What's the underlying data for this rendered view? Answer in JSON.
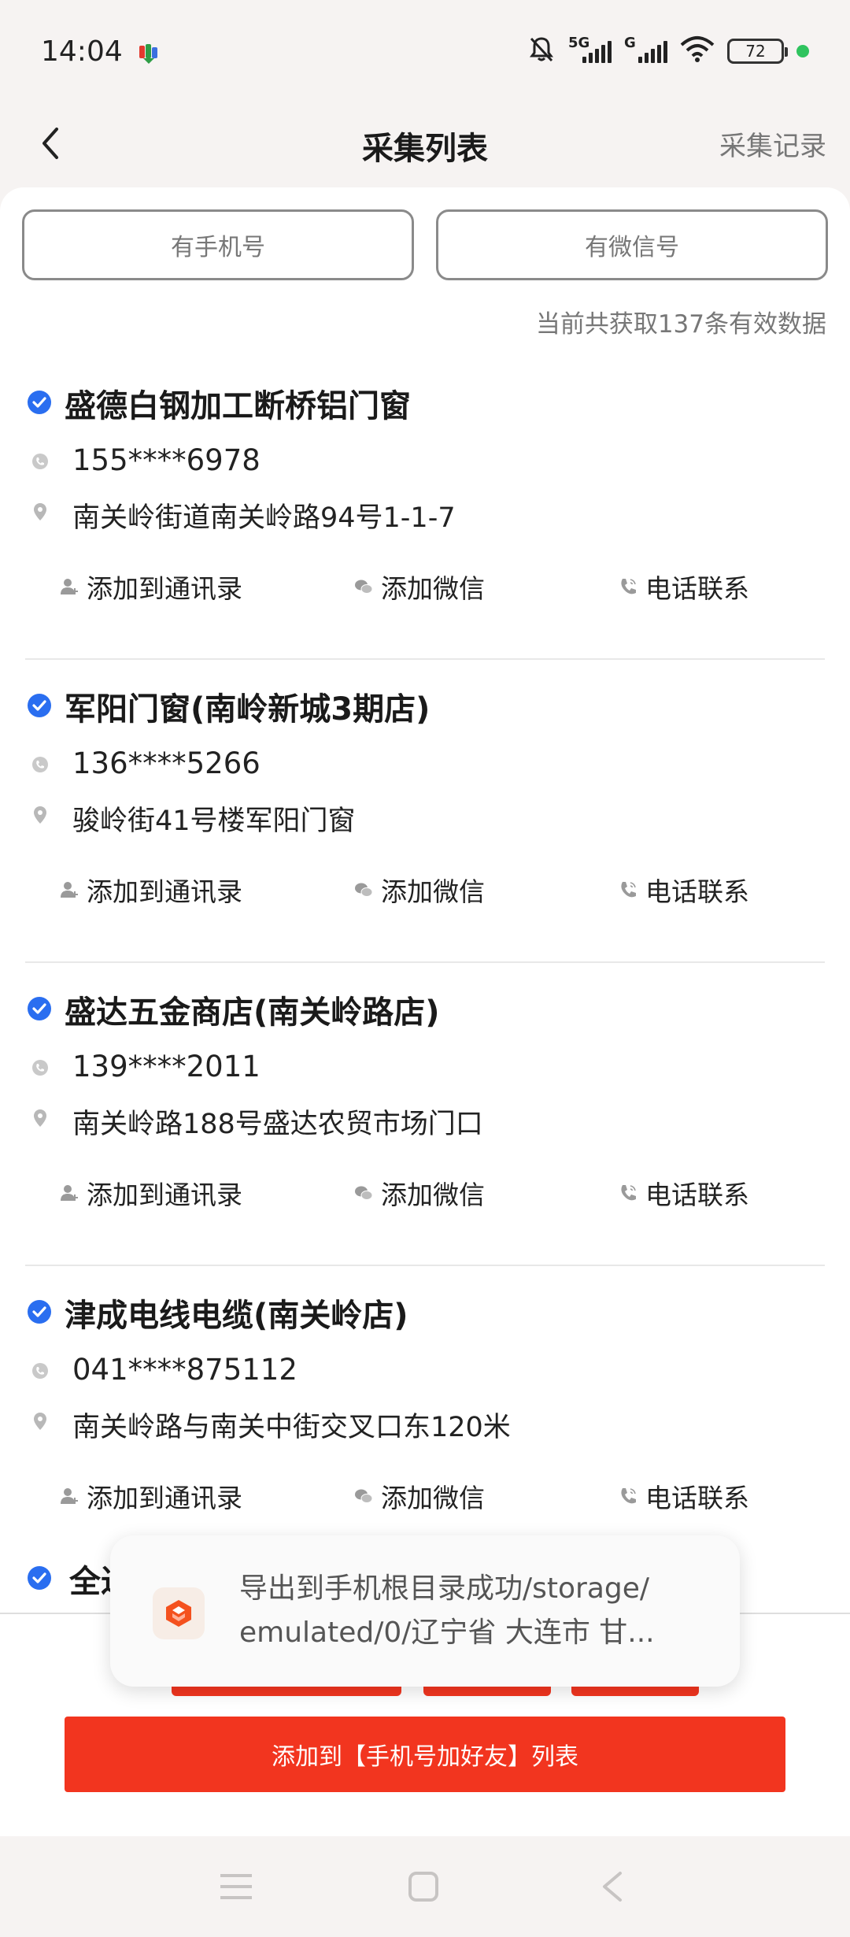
{
  "status_bar": {
    "time": "14:04",
    "battery": "72",
    "sig1_label": "5G",
    "sig2_label": "G"
  },
  "header": {
    "title": "采集列表",
    "right_link": "采集记录"
  },
  "filters": {
    "phone": "有手机号",
    "wechat": "有微信号"
  },
  "count_text": "当前共获取137条有效数据",
  "actions": {
    "add_contact": "添加到通讯录",
    "add_wechat": "添加微信",
    "call": "电话联系"
  },
  "items": [
    {
      "title": "盛德白钢加工断桥铝门窗",
      "phone": "155****6978",
      "address": "南关岭街道南关岭路94号1-1-7"
    },
    {
      "title": "军阳门窗(南岭新城3期店)",
      "phone": "136****5266",
      "address": "骏岭街41号楼军阳门窗"
    },
    {
      "title": "盛达五金商店(南关岭路店)",
      "phone": "139****2011",
      "address": "南关岭路188号盛达农贸市场门口"
    },
    {
      "title": "津成电线电缆(南关岭店)",
      "phone": "041****875112",
      "address": "南关岭路与南关中街交叉口东120米"
    }
  ],
  "partial_item_title": "全过",
  "toast": {
    "line1": "导出到手机根目录成功/storage/",
    "line2": "emulated/0/辽宁省 大连市 甘..."
  },
  "bottom_button": "添加到【手机号加好友】列表",
  "colors": {
    "accent": "#f2351f",
    "check_blue": "#2a6ef0"
  }
}
